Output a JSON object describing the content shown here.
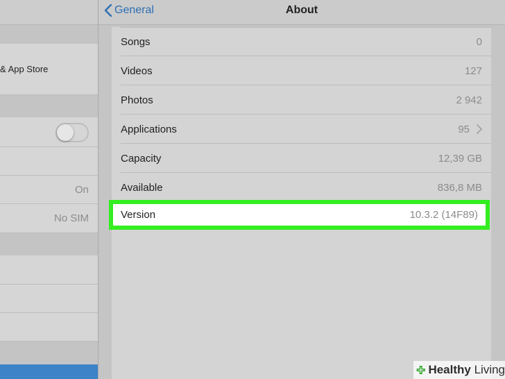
{
  "master": {
    "items": [
      {
        "label": "& App Store"
      },
      {
        "toggle_on": false
      },
      {
        "value": "On"
      },
      {
        "value": "No SIM"
      }
    ]
  },
  "nav": {
    "back_label": "General",
    "title": "About"
  },
  "about": {
    "rows": [
      {
        "label": "Songs",
        "value": "0"
      },
      {
        "label": "Videos",
        "value": "127"
      },
      {
        "label": "Photos",
        "value": "2 942"
      },
      {
        "label": "Applications",
        "value": "95"
      },
      {
        "label": "Capacity",
        "value": "12,39 GB"
      },
      {
        "label": "Available",
        "value": "836,8 MB"
      },
      {
        "label": "Version",
        "value": "10.3.2 (14F89)"
      }
    ]
  },
  "icons": {
    "back": "chevron-left-icon",
    "disclosure": "chevron-right-icon",
    "brand": "cross-plus-icon"
  },
  "colors": {
    "accent": "#2c6fb3",
    "highlight": "#33ee20",
    "selected_row": "#3d83c7",
    "brand_green": "#3aa935"
  },
  "watermark": {
    "brand_bold": "Healthy",
    "brand_light": " Living"
  }
}
